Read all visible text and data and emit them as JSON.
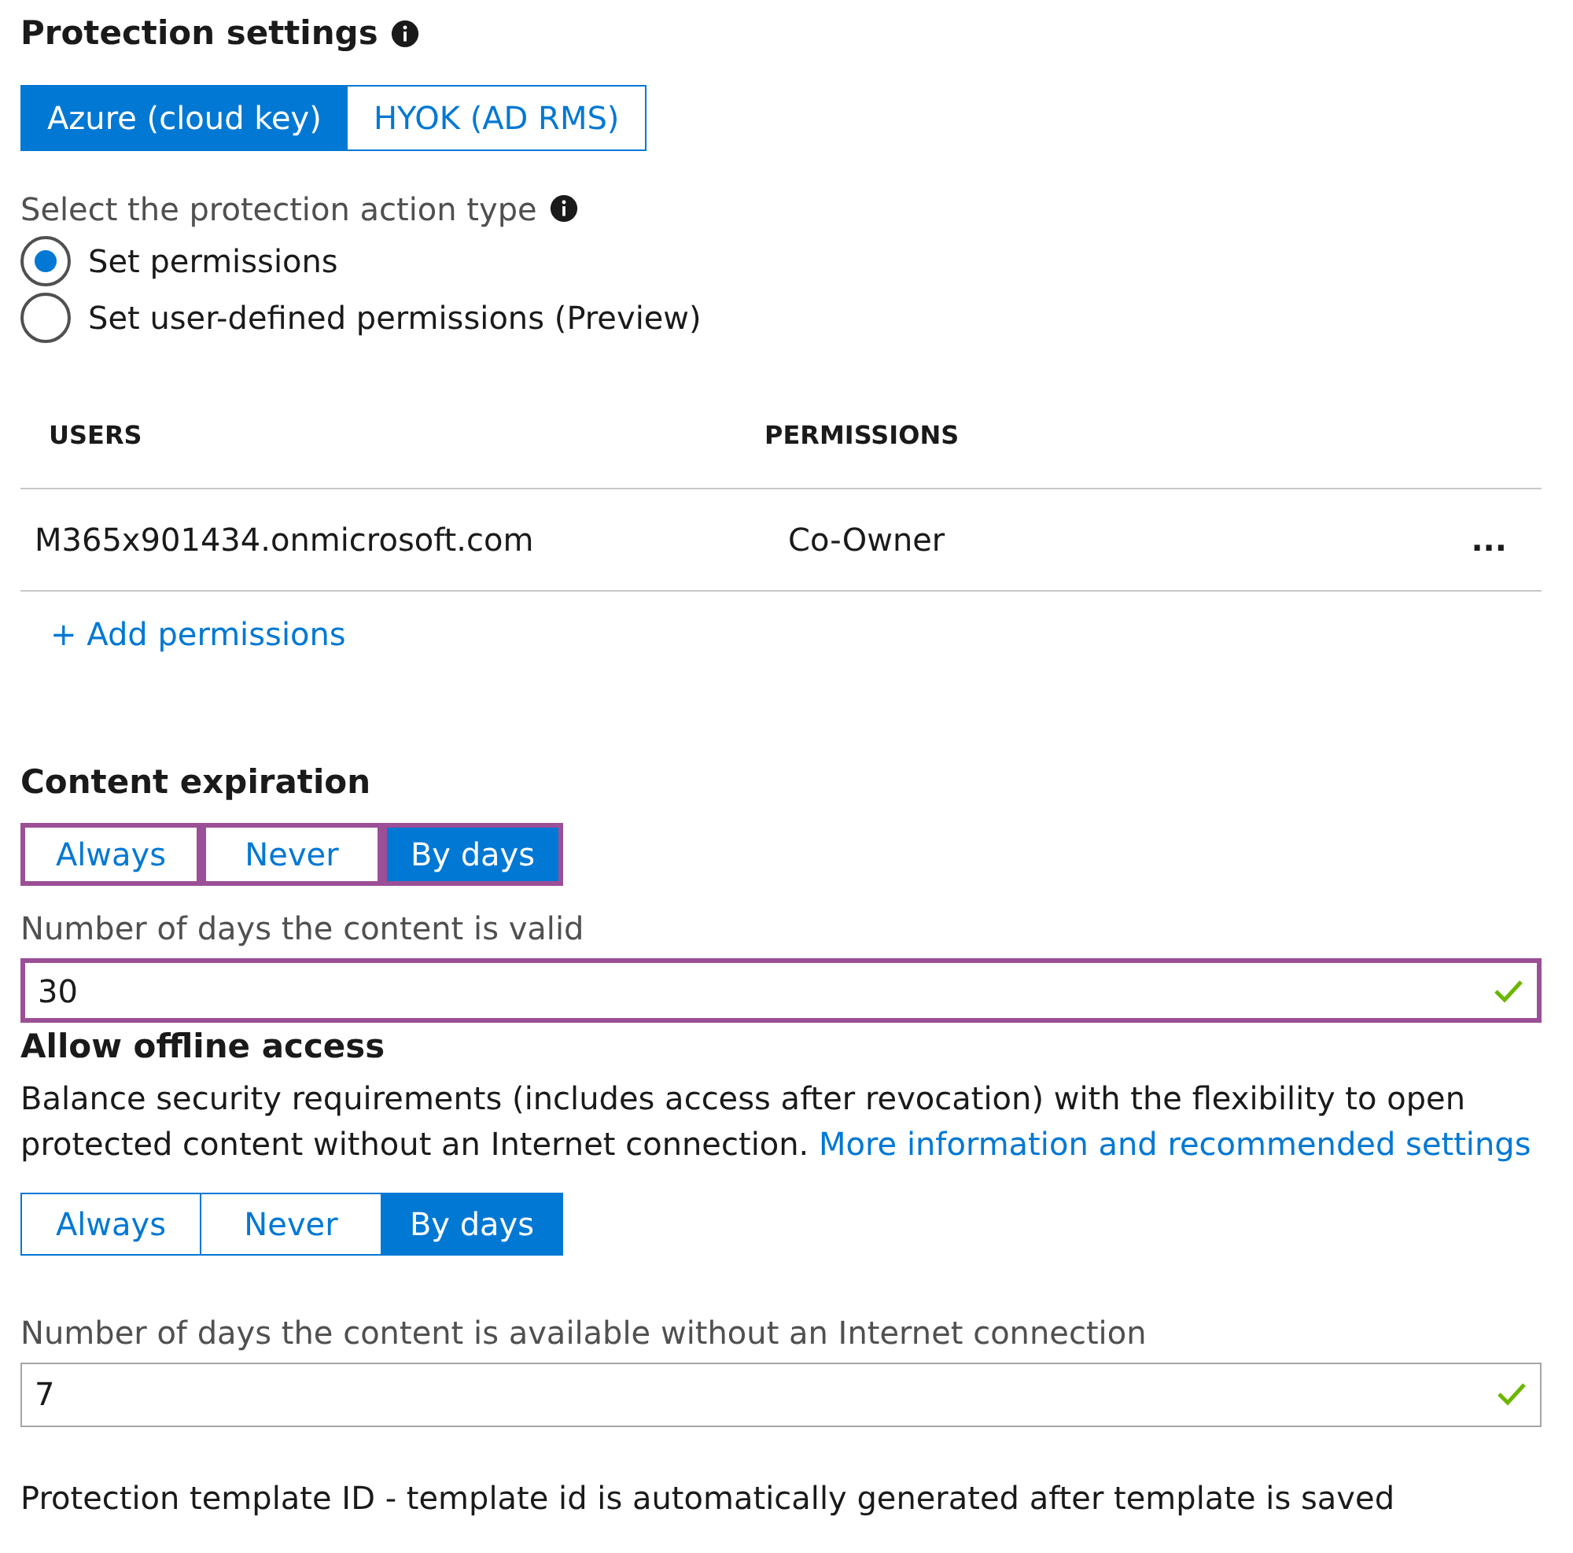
{
  "protection": {
    "title": "Protection settings",
    "key_options": [
      {
        "label": "Azure (cloud key)",
        "selected": true
      },
      {
        "label": "HYOK (AD RMS)",
        "selected": false
      }
    ],
    "action_label": "Select the protection action type",
    "action_types": [
      {
        "label": "Set permissions",
        "selected": true
      },
      {
        "label": "Set user-defined permissions (Preview)",
        "selected": false
      }
    ]
  },
  "table": {
    "columns": [
      "USERS",
      "PERMISSIONS"
    ],
    "rows": [
      {
        "user": "M365x901434.onmicrosoft.com",
        "permission": "Co-Owner",
        "menu": "..."
      }
    ],
    "add_link": "+ Add permissions"
  },
  "content_expiration": {
    "title": "Content expiration",
    "highlighted": true,
    "options": [
      {
        "label": "Always",
        "selected": false
      },
      {
        "label": "Never",
        "selected": false
      },
      {
        "label": "By days",
        "selected": true
      }
    ],
    "field_label": "Number of days the content is  valid",
    "field": {
      "value": "30",
      "valid": true,
      "highlighted": true
    }
  },
  "offline_access": {
    "title": "Allow offline access",
    "description": "Balance security requirements (includes access after revocation) with the flexibility to open protected content without an Internet connection.",
    "link": "More information and recommended settings",
    "highlighted": false,
    "options": [
      {
        "label": "Always",
        "selected": false
      },
      {
        "label": "Never",
        "selected": false
      },
      {
        "label": "By days",
        "selected": true
      }
    ],
    "field_label": "Number of days the content is available without an Internet connection",
    "field": {
      "value": "7",
      "valid": true,
      "highlighted": false
    }
  },
  "footer": "Protection template ID - template id is automatically generated after template is saved"
}
